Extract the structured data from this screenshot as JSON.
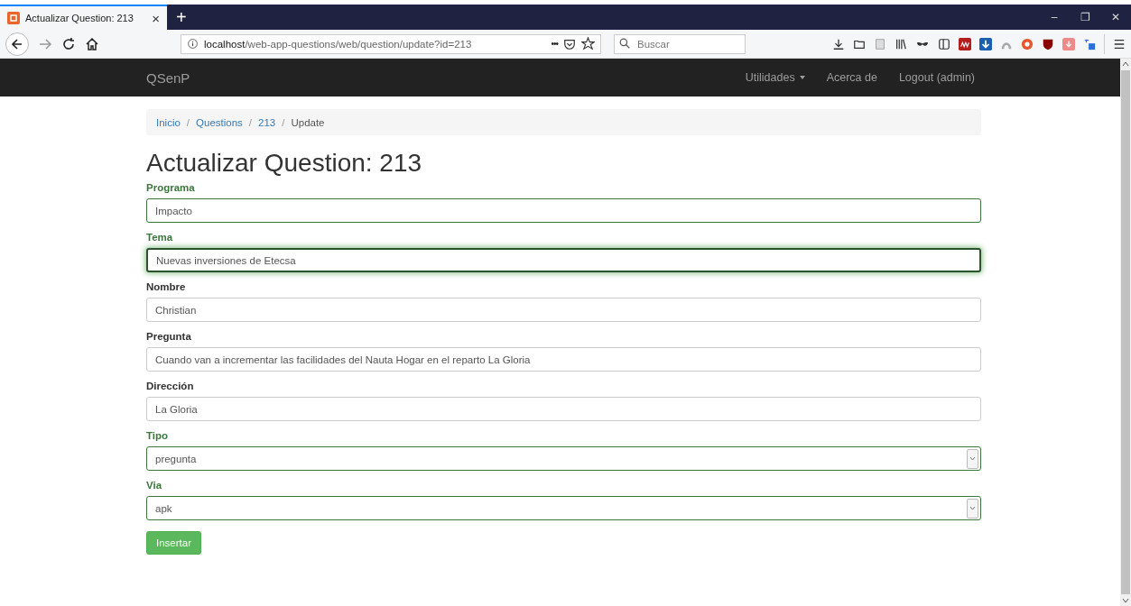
{
  "browser": {
    "tab": {
      "title": "Actualizar Question: 213",
      "close": "×",
      "new": "+"
    },
    "window_controls": [
      "–",
      "❐",
      "✕"
    ],
    "address": {
      "host": "localhost",
      "path": "/web-app-questions/web/question/update?id=213"
    },
    "more": "•••",
    "search": {
      "placeholder": "Buscar"
    }
  },
  "navbar": {
    "brand": "QSenP",
    "items": [
      {
        "label": "Utilidades",
        "dropdown": true
      },
      {
        "label": "Acerca de",
        "dropdown": false
      },
      {
        "label": "Logout (admin)",
        "dropdown": false
      }
    ]
  },
  "breadcrumb_separator": "/",
  "breadcrumb": [
    {
      "label": "Inicio",
      "link": true
    },
    {
      "label": "Questions",
      "link": true
    },
    {
      "label": "213",
      "link": true
    },
    {
      "label": "Update",
      "link": false
    }
  ],
  "heading": "Actualizar Question: 213",
  "fields": [
    {
      "label": "Programa",
      "kind": "text",
      "value": "Impacto",
      "validated": true,
      "focused": false
    },
    {
      "label": "Tema",
      "kind": "text",
      "value": "Nuevas inversiones de Etecsa",
      "validated": true,
      "focused": true
    },
    {
      "label": "Nombre",
      "kind": "text",
      "value": "Christian",
      "validated": false,
      "focused": false
    },
    {
      "label": "Pregunta",
      "kind": "text",
      "value": "Cuando van a incrementar las facilidades del Nauta Hogar en el reparto La Gloria",
      "validated": false,
      "focused": false
    },
    {
      "label": "Dirección",
      "kind": "text",
      "value": "La Gloria",
      "validated": false,
      "focused": false
    },
    {
      "label": "Tipo",
      "kind": "select",
      "value": "pregunta",
      "validated": true,
      "focused": false
    },
    {
      "label": "Via",
      "kind": "select",
      "value": "apk",
      "validated": true,
      "focused": false
    }
  ],
  "submit": "Insertar"
}
